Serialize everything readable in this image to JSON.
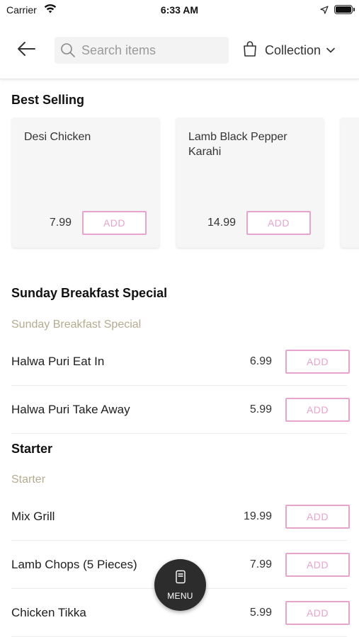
{
  "status_bar": {
    "carrier": "Carrier",
    "time": "6:33 AM"
  },
  "header": {
    "search_placeholder": "Search items",
    "collection_label": "Collection"
  },
  "best_selling": {
    "title": "Best Selling",
    "items": [
      {
        "name": "Desi Chicken",
        "price": "7.99",
        "add_label": "ADD"
      },
      {
        "name": "Lamb Black Pepper Karahi",
        "price": "14.99",
        "add_label": "ADD"
      }
    ]
  },
  "sections": [
    {
      "title": "Sunday Breakfast Special",
      "subtitle": "Sunday Breakfast Special",
      "items": [
        {
          "name": "Halwa Puri Eat In",
          "price": "6.99",
          "add_label": "ADD"
        },
        {
          "name": "Halwa Puri Take Away",
          "price": "5.99",
          "add_label": "ADD"
        }
      ]
    },
    {
      "title": "Starter",
      "subtitle": "Starter",
      "items": [
        {
          "name": "Mix Grill",
          "price": "19.99",
          "add_label": "ADD"
        },
        {
          "name": "Lamb Chops (5 Pieces)",
          "price": "7.99",
          "add_label": "ADD"
        },
        {
          "name": "Chicken Tikka",
          "price": "5.99",
          "add_label": "ADD"
        }
      ]
    }
  ],
  "menu_fab": {
    "label": "MENU"
  },
  "colors": {
    "accent": "#e8a3cf",
    "subtitle": "#b5ab8f",
    "fab": "#2c2c2c"
  }
}
